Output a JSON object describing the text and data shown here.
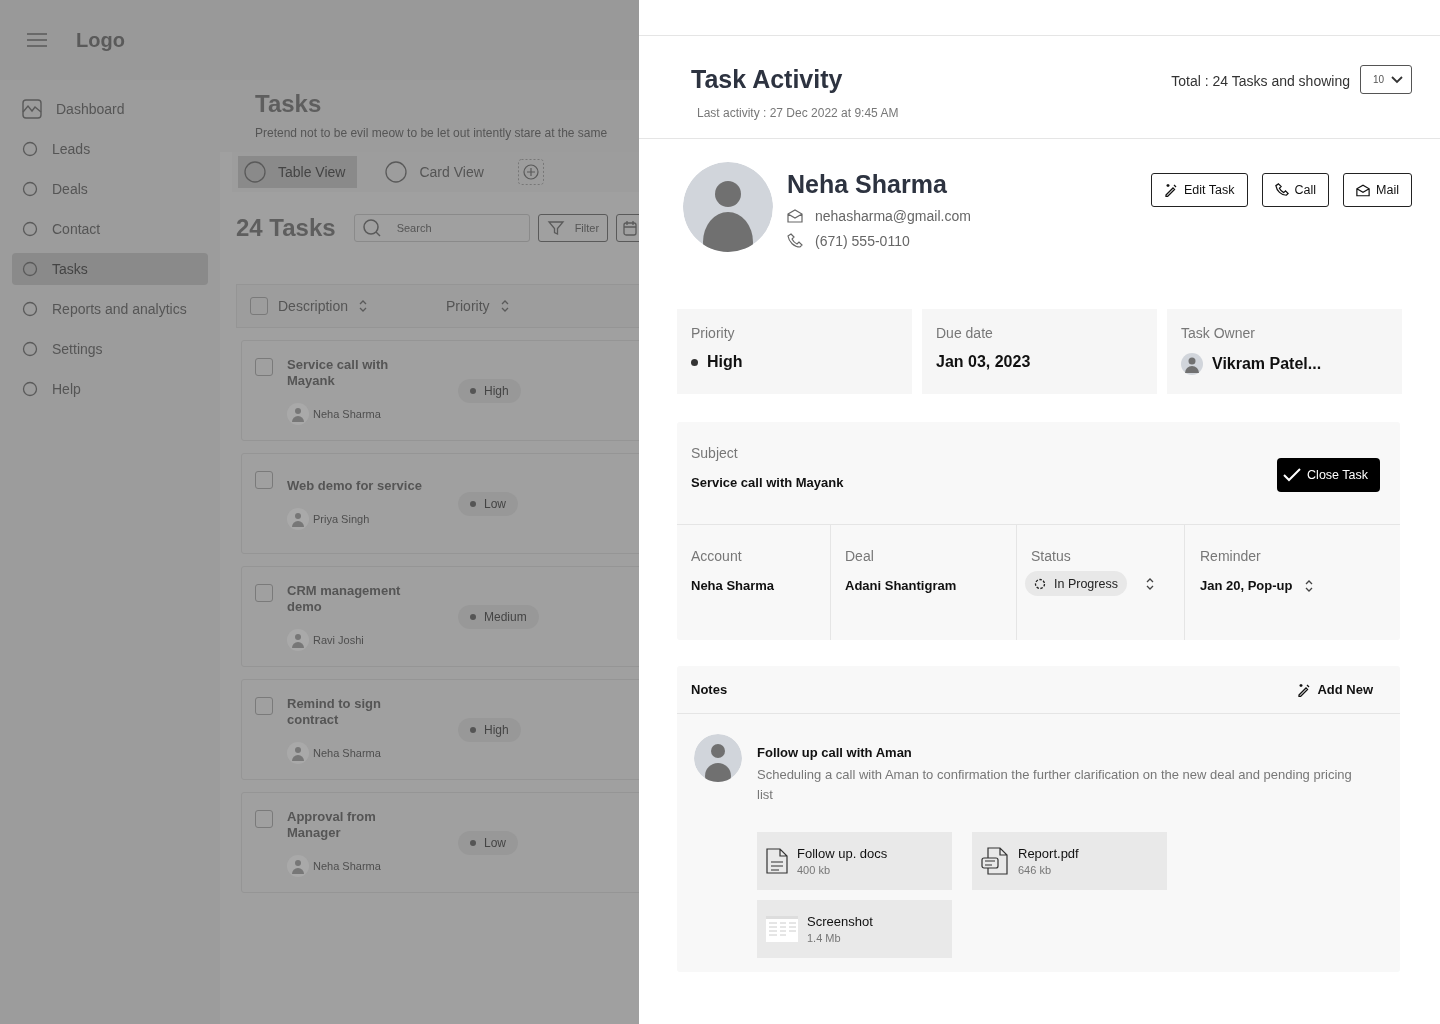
{
  "app": {
    "logo": "Logo",
    "sidebar": [
      {
        "label": "Dashboard",
        "kind": "chart",
        "selected": false
      },
      {
        "label": "Leads",
        "kind": "circle",
        "selected": false
      },
      {
        "label": "Deals",
        "kind": "circle",
        "selected": false
      },
      {
        "label": "Contact",
        "kind": "circle",
        "selected": false
      },
      {
        "label": "Tasks",
        "kind": "circle",
        "selected": true
      },
      {
        "label": "Reports and analytics",
        "kind": "circle",
        "selected": false
      },
      {
        "label": "Settings",
        "kind": "circle",
        "selected": false
      },
      {
        "label": "Help",
        "kind": "circle",
        "selected": false
      }
    ],
    "page": {
      "title": "Tasks",
      "subtitle": "Pretend not to be evil meow to be let out intently stare at the same",
      "views": [
        {
          "label": "Table View",
          "selected": true
        },
        {
          "label": "Card View",
          "selected": false
        }
      ],
      "count": "24 Tasks",
      "search": {
        "placeholder": "Search"
      },
      "filter": "Filter",
      "select_all": {
        "checked": false
      },
      "columns": [
        "Description",
        "Priority"
      ],
      "tasks": [
        {
          "title": "Service call with Mayank",
          "owner": "Neha Sharma",
          "priority": "High",
          "checked": false
        },
        {
          "title": "Web demo for service",
          "owner": "Priya Singh",
          "priority": "Low",
          "checked": false
        },
        {
          "title": "CRM management demo",
          "owner": "Ravi Joshi",
          "priority": "Medium",
          "checked": false
        },
        {
          "title": "Remind to sign contract",
          "owner": "Neha Sharma",
          "priority": "High",
          "checked": false
        },
        {
          "title": "Approval from Manager",
          "owner": "Neha Sharma",
          "priority": "Low",
          "checked": false
        }
      ]
    }
  },
  "drawer": {
    "title": "Task Activity",
    "last_activity": "Last activity : 27 Dec 2022 at 9:45 AM",
    "total": "Total : 24 Tasks and showing",
    "page_size": "10",
    "contact": {
      "name": "Neha Sharma",
      "email": "nehasharma@gmail.com",
      "phone": "(671) 555-0110"
    },
    "actions": [
      {
        "label": "Edit Task",
        "kind": "edit"
      },
      {
        "label": "Call",
        "kind": "call"
      },
      {
        "label": "Mail",
        "kind": "mail"
      }
    ],
    "summary": [
      {
        "label": "Priority",
        "value": "High",
        "kind": "priority"
      },
      {
        "label": "Due date",
        "value": "Jan 03, 2023",
        "kind": "text"
      },
      {
        "label": "Task Owner",
        "value": "Vikram Patel...",
        "kind": "owner"
      }
    ],
    "subject": {
      "label": "Subject",
      "value": "Service call with Mayank"
    },
    "close_button": "Close Task",
    "details": [
      {
        "label": "Account",
        "value": "Neha Sharma",
        "kind": "text"
      },
      {
        "label": "Deal",
        "value": "Adani Shantigram",
        "kind": "text"
      },
      {
        "label": "Status",
        "value": "In Progress",
        "kind": "status"
      },
      {
        "label": "Reminder",
        "value": "Jan 20, Pop-up",
        "kind": "select"
      }
    ],
    "notes": {
      "title": "Notes",
      "add": "Add New",
      "items": [
        {
          "title": "Follow up call with Aman",
          "body": "Scheduling a call with Aman to confirmation the further clarification on the new deal and pending pricing list",
          "attachments": [
            {
              "name": "Follow up. docs",
              "size": "400 kb",
              "kind": "doc"
            },
            {
              "name": "Report.pdf",
              "size": "646 kb",
              "kind": "pdf"
            },
            {
              "name": "Screenshot",
              "size": "1.4 Mb",
              "kind": "image"
            }
          ]
        }
      ]
    }
  }
}
